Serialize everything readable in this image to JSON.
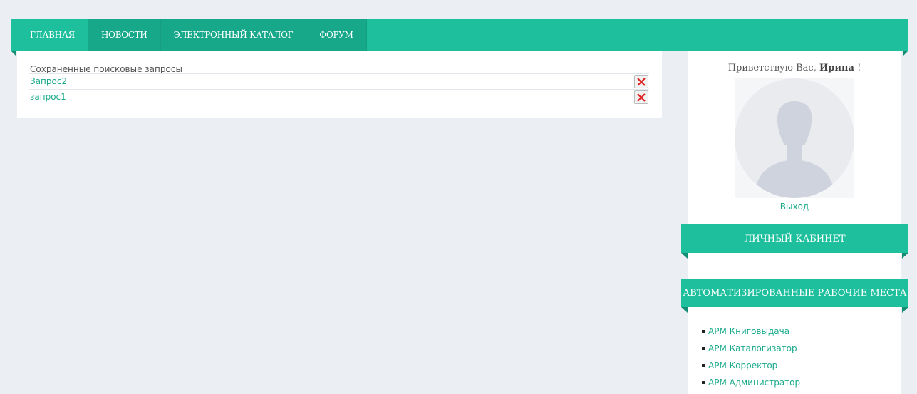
{
  "nav": {
    "items": [
      {
        "label": "ГЛАВНАЯ"
      },
      {
        "label": "НОВОСТИ"
      },
      {
        "label": "ЭЛЕКТРОННЫЙ КАТАЛОГ"
      },
      {
        "label": "ФОРУМ"
      }
    ]
  },
  "saved_searches": {
    "title": "Сохраненные поисковые запросы",
    "items": [
      {
        "name": "Запрос2"
      },
      {
        "name": "запрос1"
      }
    ]
  },
  "user": {
    "greeting_prefix": "Приветствую Вас,",
    "name": "Ирина",
    "greeting_suffix": "!",
    "logout_label": "Выход"
  },
  "sections": {
    "cabinet_title": "ЛИЧНЫЙ КАБИНЕТ",
    "arm_title": "АВТОМАТИЗИРОВАННЫЕ РАБОЧИЕ МЕСТА",
    "arm_items": [
      {
        "label": "АРМ Книговыдача"
      },
      {
        "label": "АРМ Каталогизатор"
      },
      {
        "label": "АРМ Корректор"
      },
      {
        "label": "АРМ Администратор"
      }
    ]
  },
  "colors": {
    "accent": "#1dbf9c",
    "accent_dark": "#17a88a",
    "background": "#ebeef3",
    "delete_icon": "#e02020"
  },
  "icons": {
    "delete": "close-x-icon",
    "avatar": "user-silhouette-icon"
  }
}
